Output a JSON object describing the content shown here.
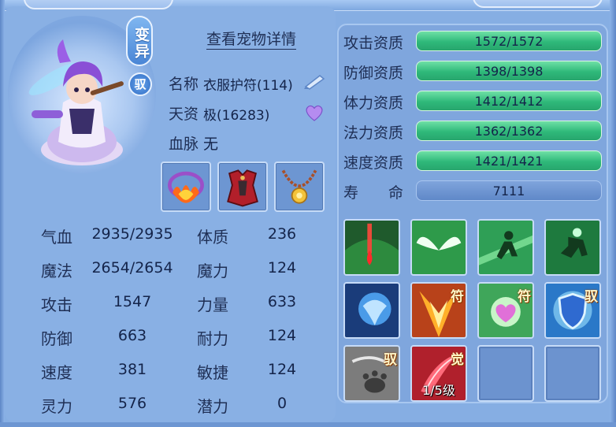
{
  "pet": {
    "mutation_button": "变异",
    "bind_badge": "驭",
    "detail_link": "查看宠物详情",
    "name_label": "名称",
    "name_value": "衣服护符(114)",
    "talent_label": "天资",
    "talent_value": "极(16283)",
    "bloodline_label": "血脉",
    "bloodline_value": "无"
  },
  "equipment": [
    {
      "icon": "flame-necklace-icon"
    },
    {
      "icon": "red-armor-icon"
    },
    {
      "icon": "gold-pendant-icon"
    }
  ],
  "stats": [
    {
      "label": "气血",
      "value": "2935/2935",
      "attr_label": "体质",
      "attr_value": "236"
    },
    {
      "label": "魔法",
      "value": "2654/2654",
      "attr_label": "魔力",
      "attr_value": "124"
    },
    {
      "label": "攻击",
      "value": "1547",
      "attr_label": "力量",
      "attr_value": "633"
    },
    {
      "label": "防御",
      "value": "663",
      "attr_label": "耐力",
      "attr_value": "124"
    },
    {
      "label": "速度",
      "value": "381",
      "attr_label": "敏捷",
      "attr_value": "124"
    },
    {
      "label": "灵力",
      "value": "576",
      "attr_label": "潜力",
      "attr_value": "0"
    }
  ],
  "aptitudes": [
    {
      "label": "攻击资质",
      "value": "1572/1572",
      "fill": 1.0
    },
    {
      "label": "防御资质",
      "value": "1398/1398",
      "fill": 1.0
    },
    {
      "label": "体力资质",
      "value": "1412/1412",
      "fill": 1.0
    },
    {
      "label": "法力资质",
      "value": "1362/1362",
      "fill": 1.0
    },
    {
      "label": "速度资质",
      "value": "1421/1421",
      "fill": 1.0
    },
    {
      "label": "寿　　命",
      "value": "7111"
    }
  ],
  "skills": [
    {
      "icon": "blood-drop-skill-icon",
      "tag": ""
    },
    {
      "icon": "white-wings-skill-icon",
      "tag": ""
    },
    {
      "icon": "dash-runner-skill-icon",
      "tag": ""
    },
    {
      "icon": "leaping-fighter-skill-icon",
      "tag": ""
    },
    {
      "icon": "ice-beast-skill-icon",
      "tag": ""
    },
    {
      "icon": "fire-burst-skill-icon",
      "tag": "符"
    },
    {
      "icon": "pink-heart-skill-icon",
      "tag": "符"
    },
    {
      "icon": "blue-shield-skill-icon",
      "tag": "驭"
    },
    {
      "icon": "grey-claw-skill-icon",
      "tag": "驭"
    },
    {
      "icon": "red-slash-skill-icon",
      "tag": "觉",
      "level": "1/5级"
    },
    {
      "icon": "empty-slot",
      "tag": ""
    },
    {
      "icon": "empty-slot",
      "tag": ""
    }
  ],
  "colors": {
    "panel": "#86aee3",
    "bar_green": "#2fb97a",
    "text": "#1f2f55"
  }
}
